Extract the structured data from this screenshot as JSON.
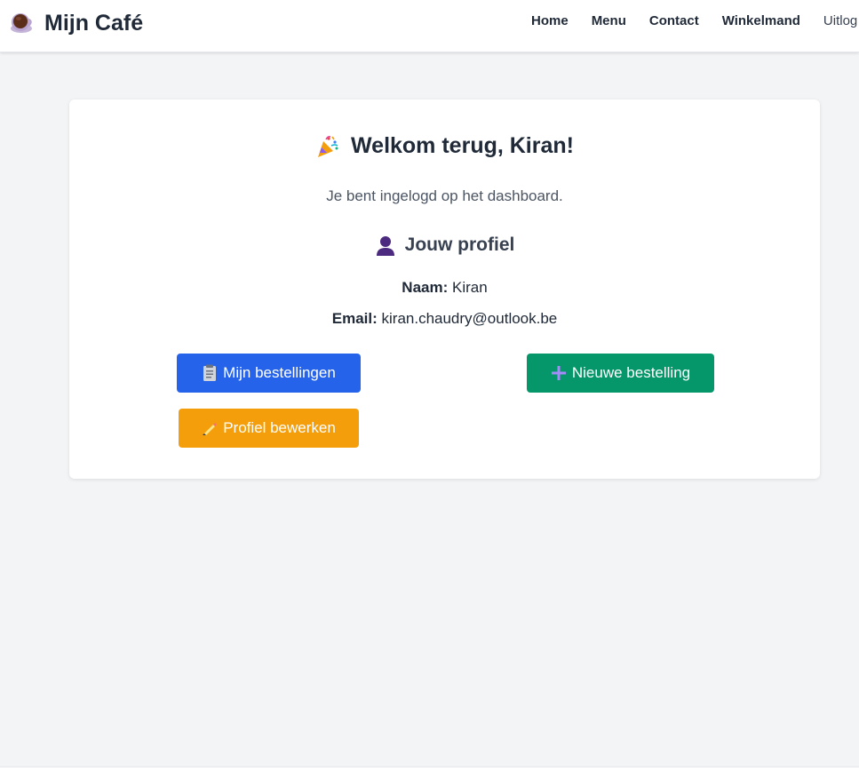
{
  "navbar": {
    "brand_icon": "coffee-cup-icon",
    "brand_name": "Mijn Café",
    "links": [
      {
        "label": "Home"
      },
      {
        "label": "Menu"
      },
      {
        "label": "Contact"
      },
      {
        "label": "Winkelmand"
      },
      {
        "label": "Uitlog"
      }
    ]
  },
  "dashboard": {
    "welcome_icon": "party-popper-icon",
    "welcome_text": "Welkom terug, Kiran!",
    "subtitle": "Je bent ingelogd op het dashboard.",
    "profile_icon": "user-silhouette-icon",
    "profile_title": "Jouw profiel",
    "naam_label": "Naam:",
    "naam_value": "Kiran",
    "email_label": "Email:",
    "email_value": "kiran.chaudry@outlook.be"
  },
  "buttons": {
    "orders": {
      "label": "Mijn bestellingen",
      "icon": "clipboard-icon",
      "color": "#2563eb"
    },
    "new_order": {
      "label": "Nieuwe bestelling",
      "icon": "plus-icon",
      "color": "#059669"
    },
    "edit_profile": {
      "label": "Profiel bewerken",
      "icon": "pencil-icon",
      "color": "#f59e0b"
    }
  }
}
